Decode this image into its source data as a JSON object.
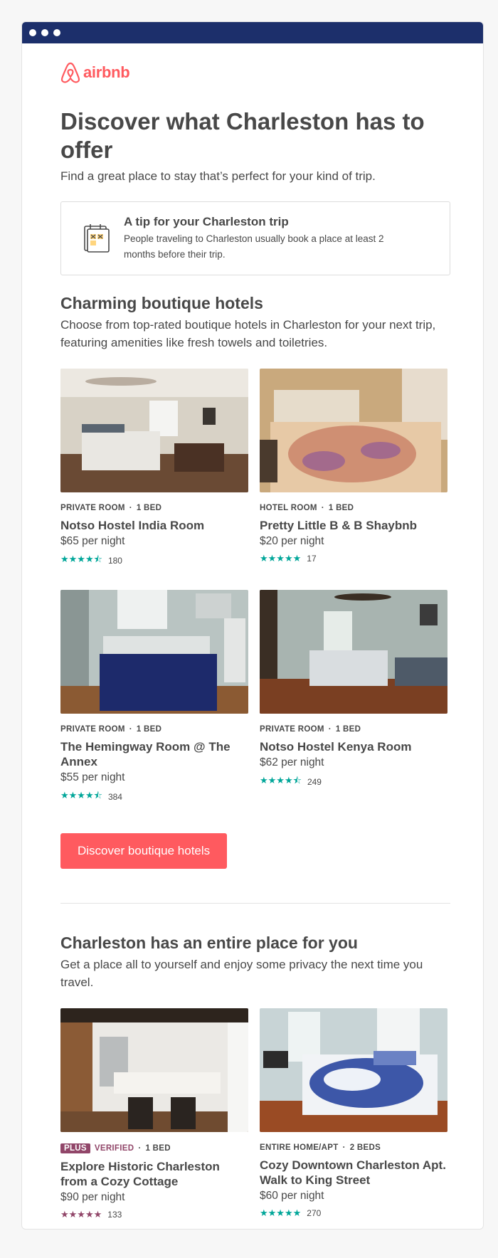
{
  "brand": {
    "name": "airbnb",
    "color": "#ff5a5f"
  },
  "window": {
    "titlebar_color": "#1c2f6b"
  },
  "headline": "Discover what Charleston has to offer",
  "subhead": "Find a great place to stay that’s perfect for your kind of trip.",
  "tip": {
    "icon": "calendar-icon",
    "title": "A tip for your Charleston trip",
    "body": "People traveling to Charleston usually book a place at least 2 months before their trip."
  },
  "section1": {
    "title": "Charming boutique hotels",
    "description": "Choose from top-rated boutique hotels in Charleston for your next trip, featuring amenities like fresh towels and toiletries.",
    "listings": [
      {
        "type": "PRIVATE ROOM",
        "beds": "1 BED",
        "name": "Notso Hostel India Room",
        "price": "$65 per night",
        "stars": "★★★★⯪",
        "reviews": "180"
      },
      {
        "type": "HOTEL ROOM",
        "beds": "1 BED",
        "name": "Pretty Little B & B Shaybnb",
        "price": "$20 per night",
        "stars": "★★★★★",
        "reviews": "17"
      },
      {
        "type": "PRIVATE ROOM",
        "beds": "1 BED",
        "name": "The Hemingway Room @ The Annex",
        "price": "$55 per night",
        "stars": "★★★★⯪",
        "reviews": "384"
      },
      {
        "type": "PRIVATE ROOM",
        "beds": "1 BED",
        "name": "Notso Hostel Kenya Room",
        "price": "$62 per night",
        "stars": "★★★★⯪",
        "reviews": "249"
      }
    ],
    "cta": "Discover boutique hotels"
  },
  "section2": {
    "title": "Charleston has an entire place for you",
    "description": "Get a place all to yourself and enjoy some privacy the next time you travel.",
    "listings": [
      {
        "badge": "PLUS",
        "verified": "VERIFIED",
        "beds": "1 BED",
        "name": "Explore Historic Charleston from a Cozy Cottage",
        "price": "$90 per night",
        "stars": "★★★★★",
        "reviews": "133"
      },
      {
        "type": "ENTIRE HOME/APT",
        "beds": "2 BEDS",
        "name": "Cozy Downtown Charleston Apt. Walk to King Street",
        "price": "$60 per night",
        "stars": "★★★★★",
        "reviews": "270"
      }
    ]
  },
  "colors": {
    "accent": "#ff5a5f",
    "rating": "#00a699",
    "plus": "#914669",
    "text": "#484848"
  }
}
